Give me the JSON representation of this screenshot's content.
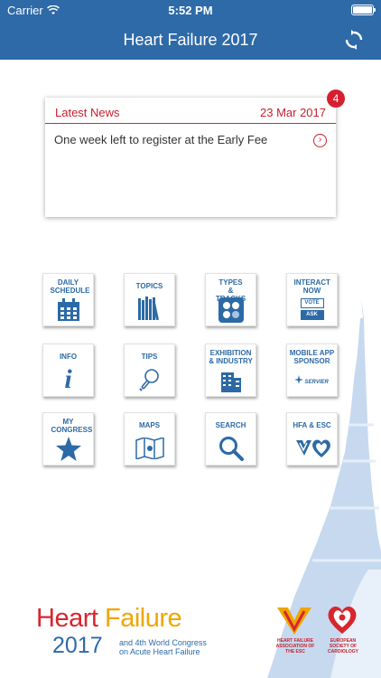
{
  "status_bar": {
    "carrier": "Carrier",
    "time": "5:52 PM"
  },
  "nav": {
    "title": "Heart Failure 2017"
  },
  "news": {
    "header": "Latest News",
    "date": "23 Mar 2017",
    "badge_count": "4",
    "items": [
      "One week left to register at the Early Fee"
    ]
  },
  "menu": [
    {
      "label": "DAILY SCHEDULE",
      "icon": "calendar-icon"
    },
    {
      "label": "TOPICS",
      "icon": "books-icon"
    },
    {
      "label": "TYPES & TRACKS",
      "icon": "tracks-icon"
    },
    {
      "label": "INTERACT NOW",
      "icon": "vote-ask-icon",
      "vote": "VOTE",
      "ask": "ASK"
    },
    {
      "label": "INFO",
      "icon": "info-icon"
    },
    {
      "label": "TIPS",
      "icon": "lightbulb-icon"
    },
    {
      "label": "EXHIBITION & INDUSTRY",
      "icon": "building-icon"
    },
    {
      "label": "MOBILE APP SPONSOR",
      "icon": "servier-logo",
      "sponsor": "SERVIER"
    },
    {
      "label": "MY CONGRESS",
      "icon": "star-icon"
    },
    {
      "label": "MAPS",
      "icon": "map-icon"
    },
    {
      "label": "SEARCH",
      "icon": "search-icon"
    },
    {
      "label": "HFA & ESC",
      "icon": "hearts-icon"
    }
  ],
  "footer": {
    "brand_heart": "Heart",
    "brand_failure": "Failure",
    "brand_year": "2017",
    "subtitle_line1": "and 4th World Congress",
    "subtitle_line2": "on Acute Heart Failure",
    "hfa_text": "HEART FAILURE ASSOCIATION OF THE ESC",
    "esc_text": "EUROPEAN SOCIETY OF CARDIOLOGY"
  },
  "colors": {
    "nav_blue": "#2e6aa8",
    "accent_red": "#d62030",
    "tile_blue": "#2c6aa6"
  }
}
